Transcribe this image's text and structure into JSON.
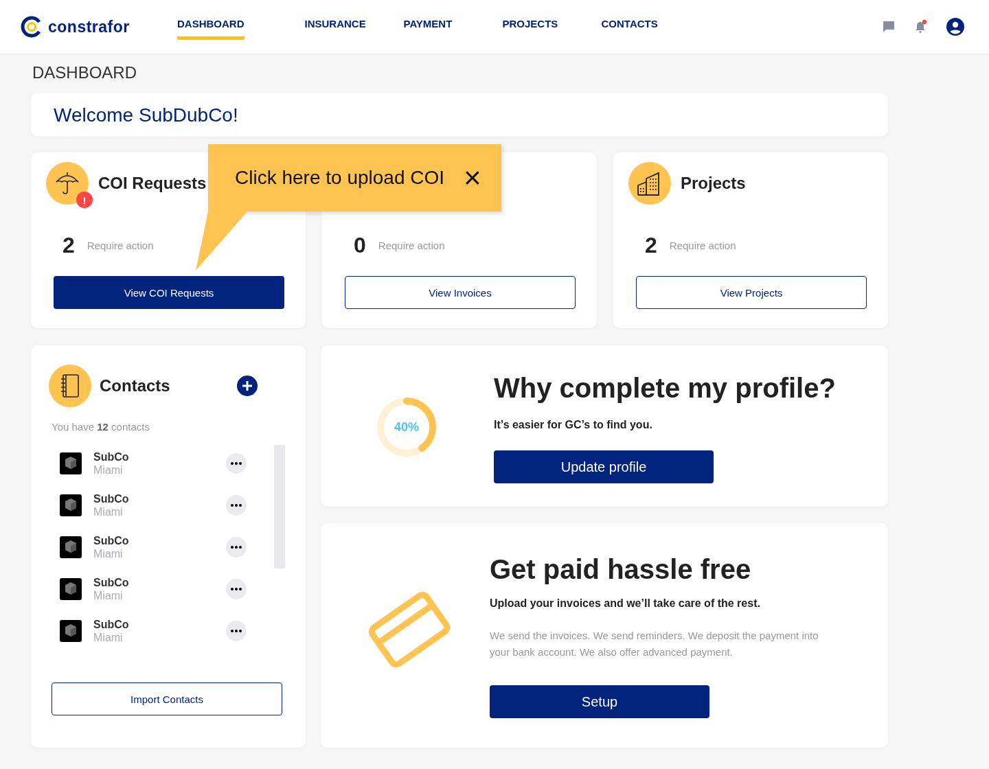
{
  "brand": "constrafor",
  "nav": [
    {
      "label": "DASHBOARD",
      "selected": true
    },
    {
      "label": "INSURANCE",
      "selected": false
    },
    {
      "label": "PAYMENT",
      "selected": false
    },
    {
      "label": "PROJECTS",
      "selected": false
    },
    {
      "label": "CONTACTS",
      "selected": false
    }
  ],
  "notifications": {
    "unread": true
  },
  "page_title": "DASHBOARD",
  "welcome": "Welcome SubDubCo!",
  "summary_cards": [
    {
      "kind": "coi",
      "title": "COI Requests",
      "badge": "!",
      "count": "2",
      "caption": "Require action",
      "button": "View COI Requests",
      "primary": true
    },
    {
      "kind": "invoices",
      "count": "0",
      "caption": "Require action",
      "button": "View Invoices",
      "primary": false
    },
    {
      "kind": "projects",
      "title": "Projects",
      "count": "2",
      "caption": "Require action",
      "button": "View Projects",
      "primary": false
    }
  ],
  "callout": {
    "text": "Click here to upload COI",
    "close": "×"
  },
  "contacts": {
    "title": "Contacts",
    "summary": "You have **12** contacts",
    "items": [
      {
        "name": "SubCo",
        "city": "Miami"
      },
      {
        "name": "SubCo",
        "city": "Miami"
      },
      {
        "name": "SubCo",
        "city": "Miami"
      },
      {
        "name": "SubCo",
        "city": "Miami"
      },
      {
        "name": "SubCo",
        "city": "Miami"
      }
    ],
    "button": "Import Contacts"
  },
  "profile": {
    "level": 0.4,
    "percent": "40%",
    "title": "Why complete my profile?",
    "subtitle": "It’s easier for GC’s to find you.",
    "button": "Update profile"
  },
  "payments": {
    "title": "Get paid hassle free",
    "subtitle": "Upload your invoices and we’ll take care of the rest.",
    "body": "We send the invoices. We send reminders. We deposit the payment into your bank account. We also offer advanced payment.",
    "button": "Setup"
  }
}
